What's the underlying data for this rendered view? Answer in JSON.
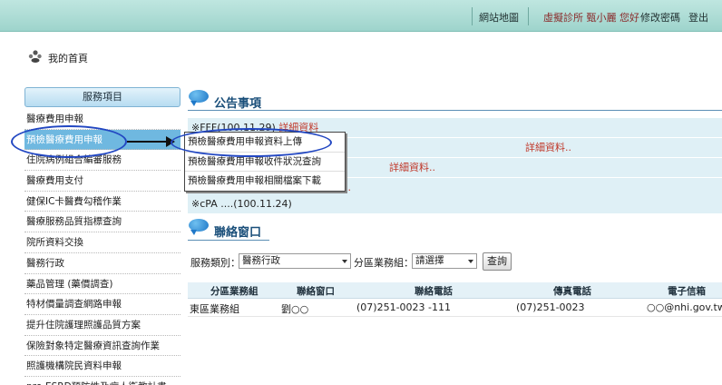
{
  "topbar": {
    "sitemap": "網站地圖",
    "user_greeting": "虛擬診所 甄小麗 您好",
    "change_password": "修改密碼",
    "logout": "登出"
  },
  "home": {
    "title": "我的首頁"
  },
  "sidebar": {
    "header": "服務項目",
    "items": [
      "醫療費用申報",
      "預檢醫療費用申報",
      "住院病例組合編審服務",
      "醫療費用支付",
      "健保IC卡醫費勾稽作業",
      "醫療服務品質指標查詢",
      "院所資料交換",
      "醫務行政",
      "藥品管理 (藥價調查)",
      "特材價量調查網路申報",
      "提升住院護理照護品質方案",
      "保險對象特定醫療資訊查詢作業",
      "照護機構院民資料申報",
      "pre-ESRD預防性及病人衛教計畫"
    ]
  },
  "dropdown": {
    "items": [
      "預檢醫療費用申報資料上傳",
      "預檢醫療費用申報收件狀況查詢",
      "預檢醫療費用申報相關檔案下載"
    ]
  },
  "announcements": {
    "title": "公告事項",
    "rows": [
      {
        "text": "※FFF(100.11.29)",
        "link": "詳細資料"
      },
      {
        "text": "",
        "link": "詳細資料.."
      },
      {
        "text": "",
        "link": "詳細資料.."
      },
      {
        "text": "",
        "link": ".."
      },
      {
        "text": "※cPA ....(100.11.24)",
        "link": ""
      }
    ]
  },
  "contact": {
    "title": "聯絡窗口",
    "service_label": "服務類別：",
    "service_value": "醫務行政",
    "group_label": "分區業務組：",
    "group_value": "請選擇",
    "query_button": "查詢",
    "columns": [
      "分區業務組",
      "聯絡窗口",
      "聯絡電話",
      "傳真電話",
      "電子信箱"
    ],
    "rows": [
      [
        "東區業務組",
        "劉○○",
        "(07)251-0023 -111",
        "(07)251-0023",
        "○○@nhi.gov.tw"
      ]
    ]
  },
  "colors": {
    "topbar": "#a6d8d0",
    "active_item": "#6fb8e0",
    "highlight_oval": "#2247c2",
    "link_red": "#c0392b",
    "section_title": "#1a4f7a"
  }
}
